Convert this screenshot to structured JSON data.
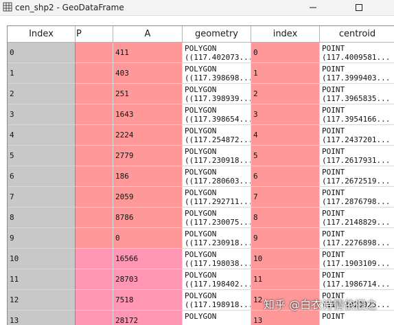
{
  "window": {
    "title": "cen_shp2 - GeoDataFrame",
    "minimize_icon": "minimize-icon",
    "maximize_icon": "maximize-icon",
    "app_icon": "table-grid-icon"
  },
  "table": {
    "headers": {
      "index": "Index",
      "p": "P",
      "a": "A",
      "geometry": "geometry",
      "index2": "index",
      "centroid": "centroid"
    },
    "rows": [
      {
        "index": "0",
        "a": "411",
        "geom1": "POLYGON",
        "geom2": "((117.402073...",
        "idx": "0",
        "cen1": "POINT",
        "cen2": "(117.4009581..."
      },
      {
        "index": "1",
        "a": "403",
        "geom1": "POLYGON",
        "geom2": "((117.398698...",
        "idx": "1",
        "cen1": "POINT",
        "cen2": "(117.3999403..."
      },
      {
        "index": "2",
        "a": "251",
        "geom1": "POLYGON",
        "geom2": "((117.398939...",
        "idx": "2",
        "cen1": "POINT",
        "cen2": "(117.3965835..."
      },
      {
        "index": "3",
        "a": "1643",
        "geom1": "POLYGON",
        "geom2": "((117.398654...",
        "idx": "3",
        "cen1": "POINT",
        "cen2": "(117.3954166..."
      },
      {
        "index": "4",
        "a": "2224",
        "geom1": "POLYGON",
        "geom2": "((117.254872...",
        "idx": "4",
        "cen1": "POINT",
        "cen2": "(117.2437201..."
      },
      {
        "index": "5",
        "a": "2779",
        "geom1": "POLYGON",
        "geom2": "((117.230918...",
        "idx": "5",
        "cen1": "POINT",
        "cen2": "(117.2617931..."
      },
      {
        "index": "6",
        "a": "186",
        "geom1": "POLYGON",
        "geom2": "((117.280603...",
        "idx": "6",
        "cen1": "POINT",
        "cen2": "(117.2672519..."
      },
      {
        "index": "7",
        "a": "2059",
        "geom1": "POLYGON",
        "geom2": "((117.292711...",
        "idx": "7",
        "cen1": "POINT",
        "cen2": "(117.2876798..."
      },
      {
        "index": "8",
        "a": "8786",
        "geom1": "POLYGON",
        "geom2": "((117.230075...",
        "idx": "8",
        "cen1": "POINT",
        "cen2": "(117.2148829..."
      },
      {
        "index": "9",
        "a": "0",
        "geom1": "POLYGON",
        "geom2": "((117.230918...",
        "idx": "9",
        "cen1": "POINT",
        "cen2": "(117.2276898..."
      },
      {
        "index": "10",
        "a": "16566",
        "geom1": "POLYGON",
        "geom2": "((117.198038...",
        "idx": "10",
        "cen1": "POINT",
        "cen2": "(117.1903109..."
      },
      {
        "index": "11",
        "a": "28703",
        "geom1": "POLYGON",
        "geom2": "((117.198402...",
        "idx": "11",
        "cen1": "POINT",
        "cen2": "(117.1986714..."
      },
      {
        "index": "12",
        "a": "7518",
        "geom1": "POLYGON",
        "geom2": "((117.198918...",
        "idx": "12",
        "cen1": "POINT",
        "cen2": "(117.1920025..."
      },
      {
        "index": "13",
        "a": "28172",
        "geom1": "POLYGON",
        "geom2": "",
        "idx": "13",
        "cen1": "POINT",
        "cen2": ""
      }
    ]
  },
  "colors": {
    "index_column": "#c8c8c8",
    "cell_red": "#ff9999",
    "cell_pink": "#ff96b4",
    "cell_white": "#ffffff"
  },
  "watermark": {
    "text": "知乎 @白衣诗情依旧之"
  }
}
